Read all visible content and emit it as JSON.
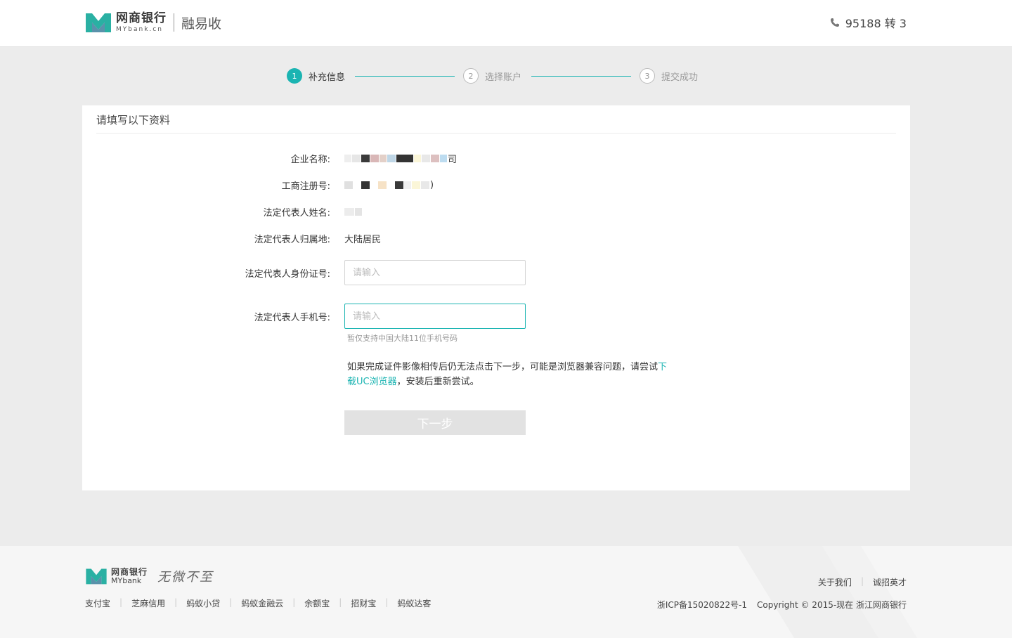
{
  "header": {
    "brand_cn": "网商银行",
    "brand_en": "MYbank.cn",
    "product": "融易收",
    "hotline": "95188 转 3"
  },
  "steps": [
    {
      "num": "1",
      "label": "补充信息",
      "state": "active"
    },
    {
      "num": "2",
      "label": "选择账户",
      "state": "inactive"
    },
    {
      "num": "3",
      "label": "提交成功",
      "state": "inactive"
    }
  ],
  "form": {
    "title": "请填写以下资料",
    "company_label": "企业名称:",
    "company_suffix": "司",
    "reg_label": "工商注册号:",
    "reg_suffix": ")",
    "rep_name_label": "法定代表人姓名:",
    "rep_region_label": "法定代表人归属地:",
    "rep_region_value": "大陆居民",
    "id_label": "法定代表人身份证号:",
    "id_placeholder": "请输入",
    "phone_label": "法定代表人手机号:",
    "phone_placeholder": "请输入",
    "phone_hint": "暂仅支持中国大陆11位手机号码",
    "notice_before": "如果完成证件影像相传后仍无法点击下一步，可能是浏览器兼容问题，请尝试",
    "notice_link": "下载UC浏览器",
    "notice_after": "，安装后重新尝试。",
    "next_button": "下一步"
  },
  "footer": {
    "brand_cn": "网商银行",
    "brand_en": "MYbank",
    "slogan": "无微不至",
    "links": [
      "支付宝",
      "芝麻信用",
      "蚂蚁小贷",
      "蚂蚁金融云",
      "余额宝",
      "招财宝",
      "蚂蚁达客"
    ],
    "right_links": [
      "关于我们",
      "诚招英才"
    ],
    "icp": "浙ICP备15020822号-1",
    "copyright": "Copyright © 2015-现在 浙江网商银行"
  },
  "colors": {
    "accent": "#1bb4b2",
    "logo_teal": "#2ab0a3",
    "logo_dark": "#3d6b8f"
  }
}
